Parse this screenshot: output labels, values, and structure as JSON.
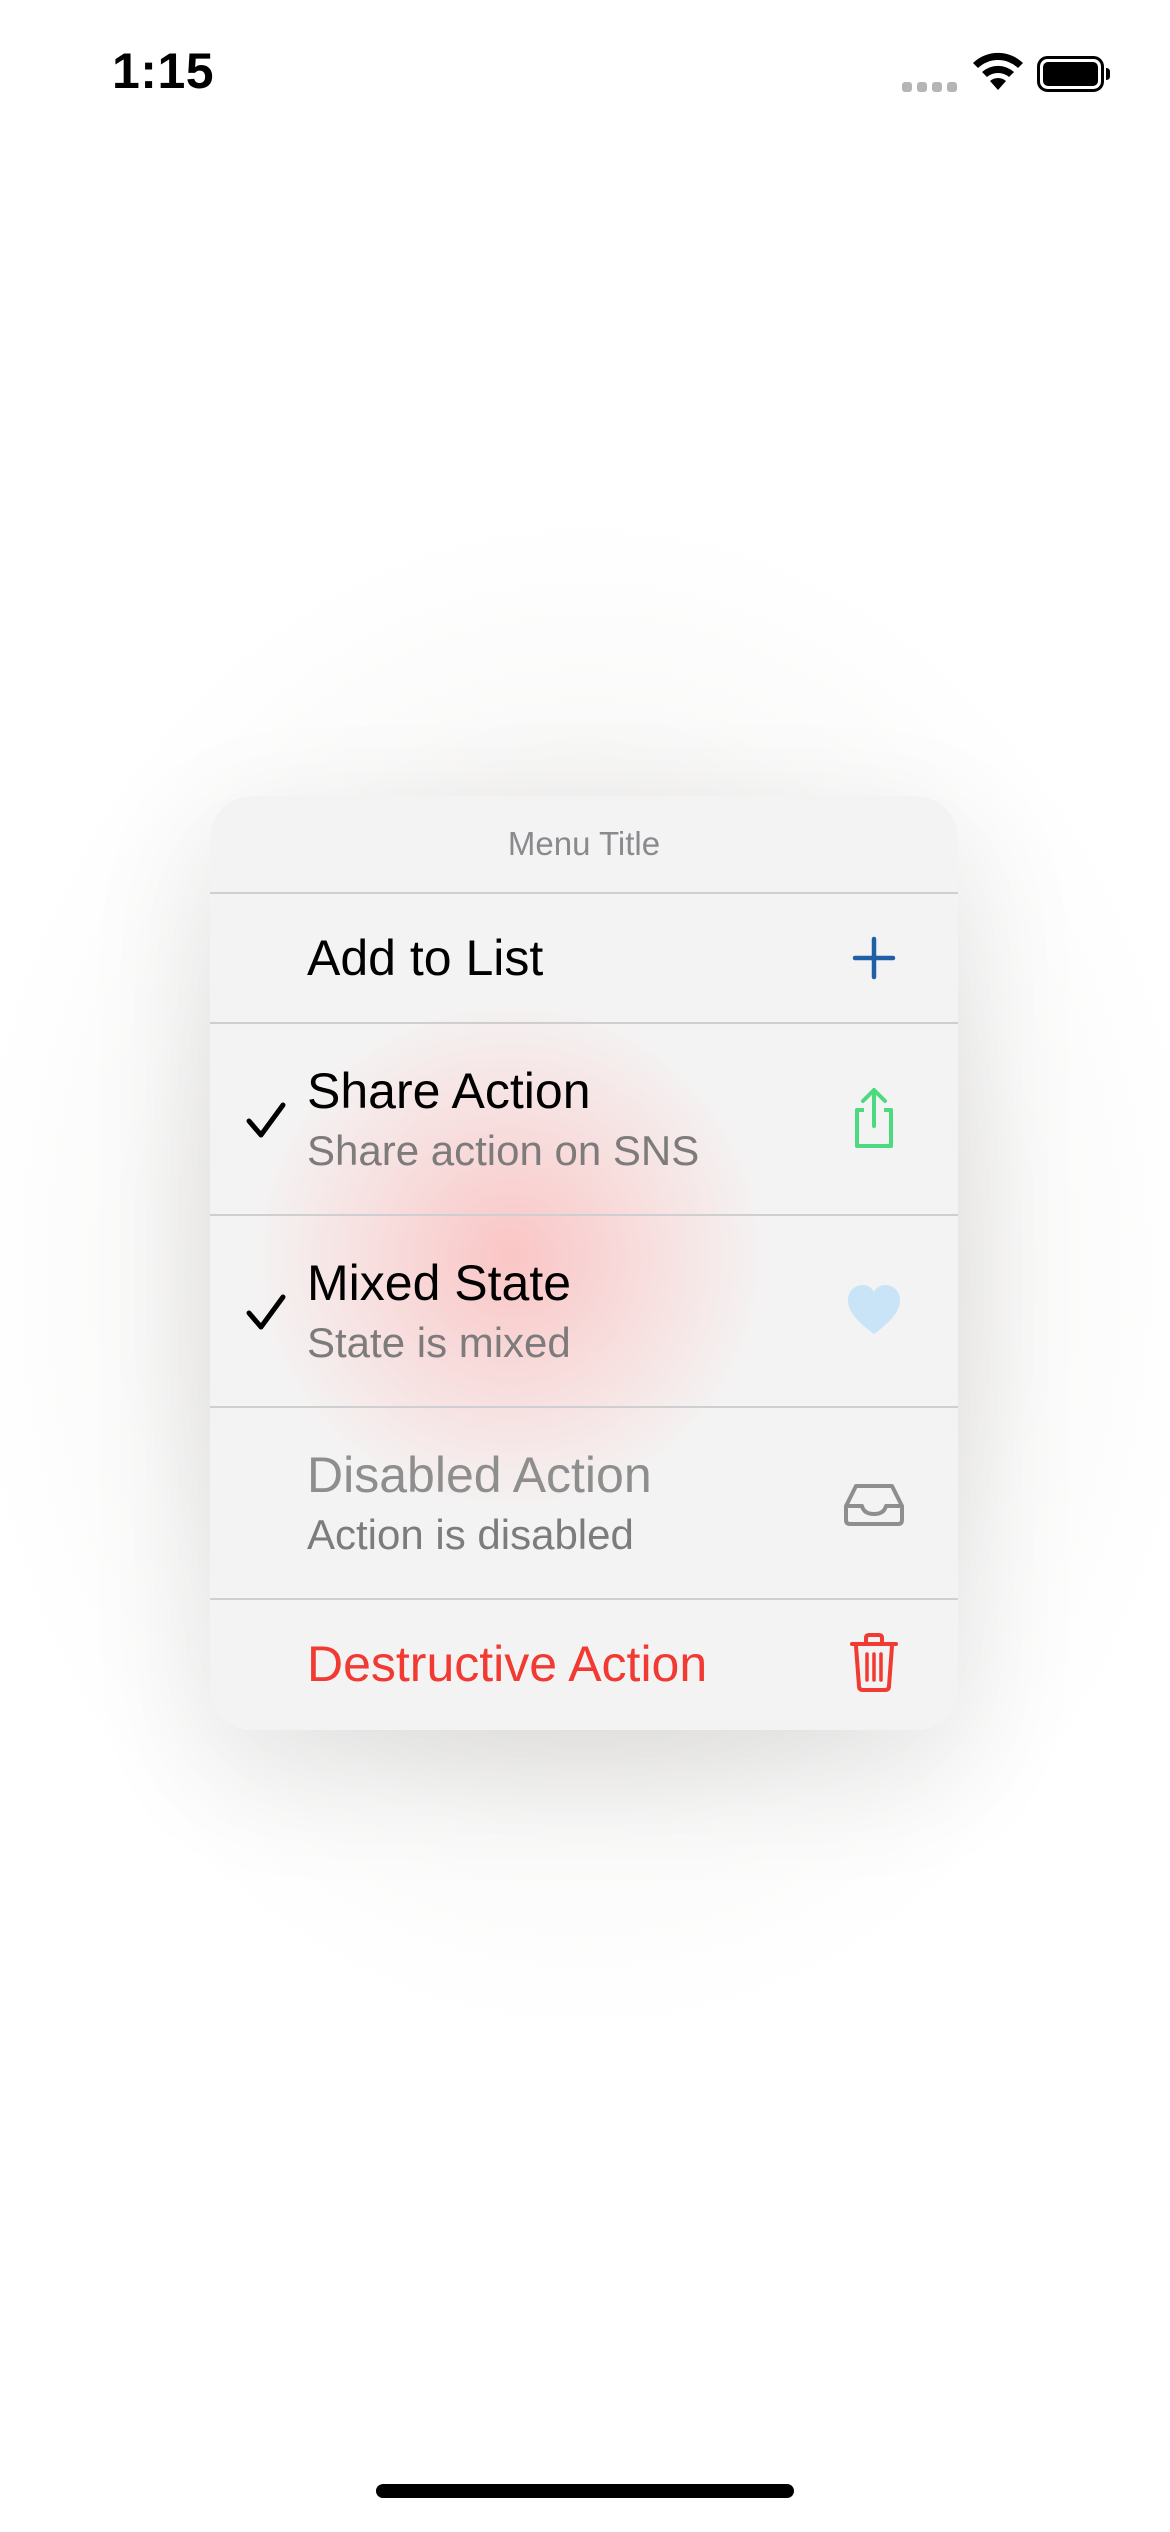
{
  "status_bar": {
    "time": "1:15",
    "signal_icon": "signal-dots-icon",
    "wifi_icon": "wifi-icon",
    "battery_icon": "battery-full-icon"
  },
  "menu": {
    "title": "Menu Title",
    "items": [
      {
        "title": "Add to List",
        "subtitle": "",
        "checked": false,
        "icon": "plus-icon",
        "icon_color": "#1f5fa6",
        "state": "normal"
      },
      {
        "title": "Share Action",
        "subtitle": "Share action on SNS",
        "checked": true,
        "icon": "share-icon",
        "icon_color": "#4cd980",
        "state": "normal"
      },
      {
        "title": "Mixed State",
        "subtitle": "State is mixed",
        "checked": true,
        "icon": "heart-icon",
        "icon_color": "#c9e4f6",
        "state": "normal"
      },
      {
        "title": "Disabled Action",
        "subtitle": "Action is disabled",
        "checked": false,
        "icon": "tray-icon",
        "icon_color": "#8e8e8e",
        "state": "disabled"
      },
      {
        "title": "Destructive Action",
        "subtitle": "",
        "checked": false,
        "icon": "trash-icon",
        "icon_color": "#f03a32",
        "state": "destructive"
      }
    ]
  },
  "colors": {
    "text_primary": "#000000",
    "text_secondary": "#7d7b7b",
    "destructive": "#f03a32",
    "separator": "#cfcfd2"
  }
}
